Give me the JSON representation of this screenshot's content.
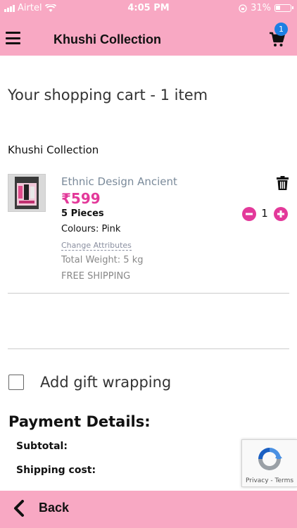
{
  "status_bar": {
    "carrier": "Airtel",
    "time": "4:05 PM",
    "battery": "31%"
  },
  "header": {
    "title": "Khushi Collection",
    "cart_count": "1"
  },
  "cart": {
    "heading": "Your shopping cart - 1 item",
    "seller": "Khushi Collection",
    "item": {
      "name": "Ethnic Design Ancient",
      "price": "₹599",
      "pieces": "5 Pieces",
      "colours": "Colours: Pink",
      "change_attributes": "Change Attributes",
      "weight": "Total Weight: 5 kg",
      "shipping": "FREE SHIPPING",
      "quantity": "1"
    }
  },
  "gift": {
    "label": "Add gift wrapping"
  },
  "payment": {
    "heading": "Payment Details:",
    "subtotal_label": "Subtotal:",
    "shipping_label": "Shipping cost:"
  },
  "recaptcha": {
    "text": "Privacy - Terms"
  },
  "footer": {
    "back_label": "Back"
  },
  "colors": {
    "accent_pink": "#f8a8c3",
    "price_pink": "#e3399a",
    "badge_blue": "#1d7fe3"
  }
}
